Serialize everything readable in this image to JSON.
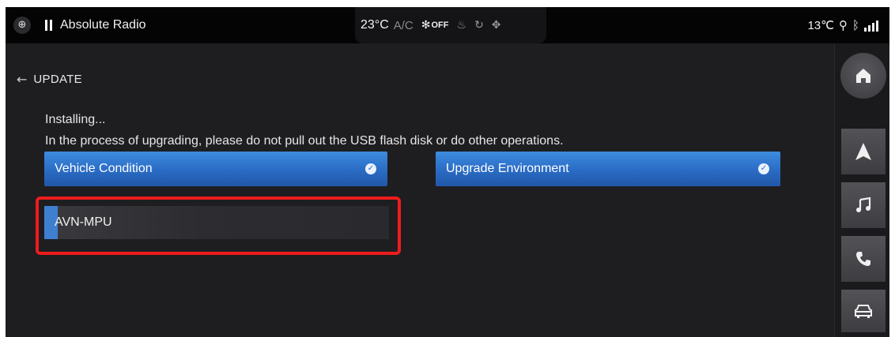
{
  "status_bar": {
    "fog_icon": "fog-light-icon",
    "playback_icon": "pause-icon",
    "radio_station": "Absolute Radio",
    "cabin_temp": "23°C",
    "ac_label": "A/C",
    "fan_label": "OFF",
    "climate_icons": [
      "fan-icon",
      "seat-heat-icon",
      "air-recirculation-icon",
      "defrost-icon"
    ],
    "outside_temp": "13℃",
    "status_icons": [
      "usb-icon",
      "bluetooth-icon",
      "signal-4g-icon"
    ]
  },
  "page": {
    "title": "UPDATE",
    "status": "Installing...",
    "notice": "In the process of upgrading, please do not pull out the USB flash disk or do other operations."
  },
  "checks": [
    {
      "label": "Vehicle Condition",
      "passed": true
    },
    {
      "label": "Upgrade Environment",
      "passed": true
    }
  ],
  "progress": {
    "label": "AVN-MPU",
    "fraction": 0.04,
    "highlighted": true,
    "fill_color": "#3f7fd0",
    "highlight_color": "#ee1c1c"
  },
  "dock": {
    "items": [
      "home-icon",
      "navigation-icon",
      "music-icon",
      "phone-icon",
      "car-icon"
    ]
  },
  "colors": {
    "accent_blue": "#2a6bc4",
    "background": "#1e1e21",
    "status_bar": "#040405"
  }
}
